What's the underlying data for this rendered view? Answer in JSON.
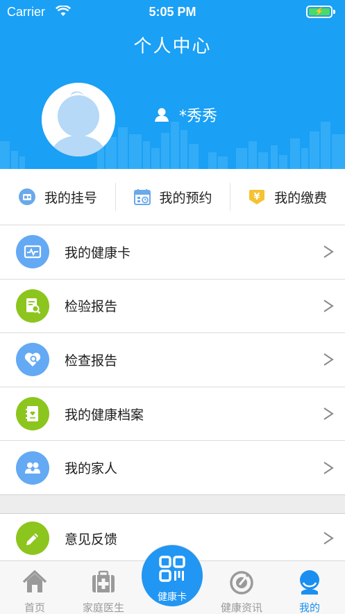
{
  "status_bar": {
    "carrier": "Carrier",
    "time": "5:05 PM"
  },
  "header": {
    "title": "个人中心",
    "user_name": "*秀秀"
  },
  "quick_actions": [
    {
      "label": "我的挂号",
      "icon": "register-icon",
      "color": "#6aa9ea"
    },
    {
      "label": "我的预约",
      "icon": "calendar-icon",
      "color": "#6aa9ea"
    },
    {
      "label": "我的缴费",
      "icon": "yen-payment-icon",
      "color": "#f5c232"
    }
  ],
  "menu": [
    {
      "label": "我的健康卡",
      "icon": "health-card-icon",
      "color": "#64a9f3"
    },
    {
      "label": "检验报告",
      "icon": "lab-report-icon",
      "color": "#8cc51e"
    },
    {
      "label": "检查报告",
      "icon": "exam-report-icon",
      "color": "#64a9f3"
    },
    {
      "label": "我的健康档案",
      "icon": "health-record-icon",
      "color": "#8cc51e"
    },
    {
      "label": "我的家人",
      "icon": "family-icon",
      "color": "#64a9f3"
    }
  ],
  "menu2": [
    {
      "label": "意见反馈",
      "icon": "feedback-pencil-icon",
      "color": "#8cc51e"
    }
  ],
  "tabbar": {
    "tabs": [
      {
        "label": "首页",
        "icon": "home-icon"
      },
      {
        "label": "家庭医生",
        "icon": "medical-kit-icon"
      },
      {
        "label": "健康资讯",
        "icon": "news-icon"
      },
      {
        "label": "我的",
        "icon": "profile-icon"
      }
    ],
    "center": {
      "label": "健康卡",
      "icon": "qr-code-icon"
    },
    "active_index": 3,
    "active_color": "#1a8ff0"
  },
  "colors": {
    "header": "#1aa0f5",
    "accent": "#2196f3"
  }
}
